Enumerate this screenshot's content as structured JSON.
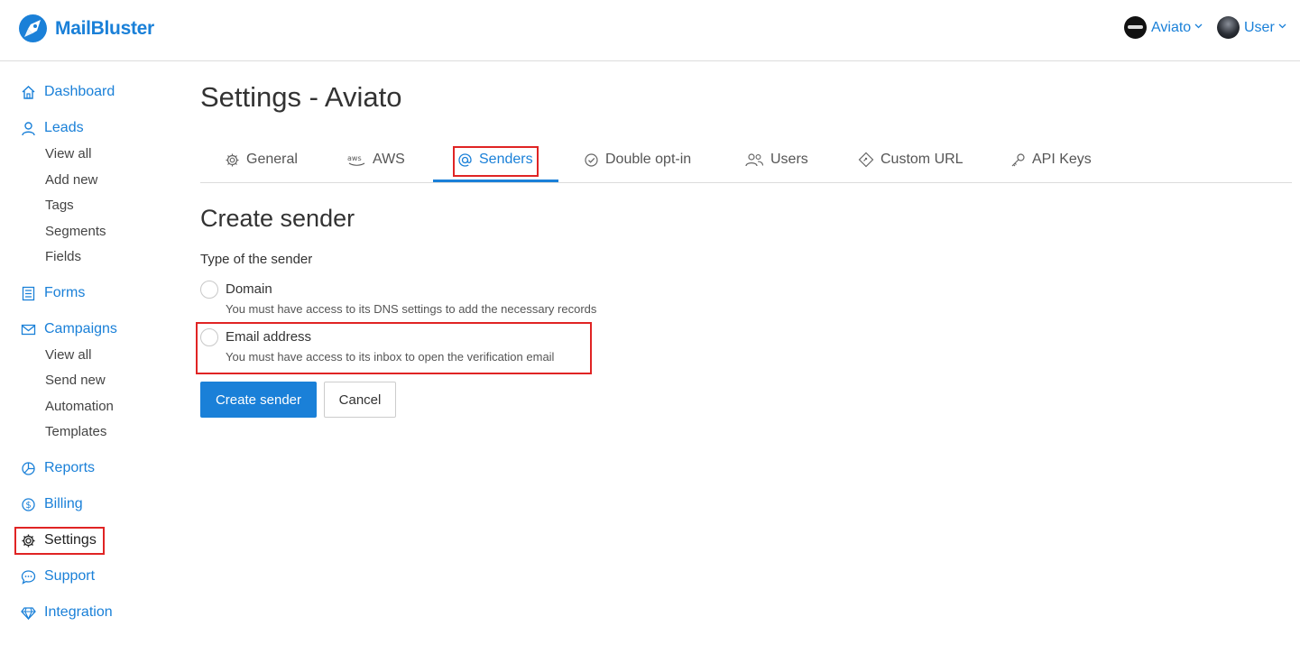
{
  "app": {
    "name": "MailBluster"
  },
  "header": {
    "brand_menu": {
      "label": "Aviato",
      "icon": "chevron-down-icon"
    },
    "user_menu": {
      "label": "User",
      "icon": "chevron-down-icon"
    }
  },
  "sidebar": {
    "dashboard": "Dashboard",
    "leads": {
      "label": "Leads",
      "items": [
        "View all",
        "Add new",
        "Tags",
        "Segments",
        "Fields"
      ]
    },
    "forms": "Forms",
    "campaigns": {
      "label": "Campaigns",
      "items": [
        "View all",
        "Send new",
        "Automation",
        "Templates"
      ]
    },
    "reports": "Reports",
    "billing": "Billing",
    "settings": "Settings",
    "support": "Support",
    "integration": "Integration",
    "active": "Settings"
  },
  "page": {
    "title": "Settings - Aviato"
  },
  "tabs": [
    {
      "label": "General",
      "icon": "gear-icon"
    },
    {
      "label": "AWS",
      "icon": "aws-icon"
    },
    {
      "label": "Senders",
      "icon": "at-sign-icon",
      "active": true
    },
    {
      "label": "Double opt-in",
      "icon": "check-circle-icon"
    },
    {
      "label": "Users",
      "icon": "users-icon"
    },
    {
      "label": "Custom URL",
      "icon": "link-diamond-icon"
    },
    {
      "label": "API Keys",
      "icon": "key-icon"
    }
  ],
  "form": {
    "title": "Create sender",
    "type_label": "Type of the sender",
    "options": [
      {
        "label": "Domain",
        "help": "You must have access to its DNS settings to add the necessary records",
        "selected": false
      },
      {
        "label": "Email address",
        "help": "You must have access to its inbox to open the verification email",
        "selected": false
      }
    ],
    "submit_label": "Create sender",
    "cancel_label": "Cancel"
  },
  "colors": {
    "accent": "#1a80d8",
    "highlight": "#e02424",
    "border": "#dcdcdc"
  }
}
